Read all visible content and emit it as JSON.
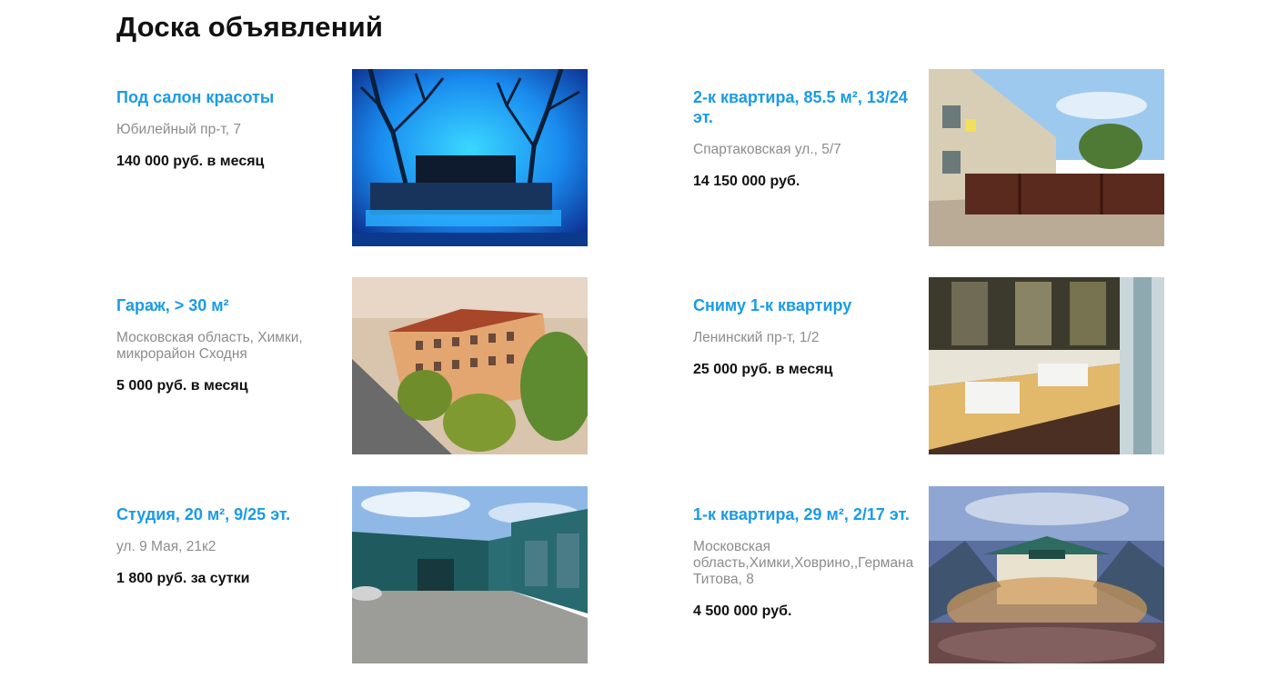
{
  "page": {
    "title": "Доска объявлений"
  },
  "listings": [
    {
      "title": "Под салон красоты",
      "address": "Юбилейный пр-т, 7",
      "price": "140 000 руб. в месяц",
      "photo": "blue-lit-room-photo"
    },
    {
      "title": "2-к квартира, 85.5 м², 13/24 эт.",
      "address": "Спартаковская ул., 5/7",
      "price": "14 150 000 руб.",
      "photo": "building-with-fence-photo"
    },
    {
      "title": "Гараж, > 30 м²",
      "address": "Московская область, Химки, микрорайон Сходня",
      "price": "5 000 руб. в месяц",
      "photo": "building-aerial-photo"
    },
    {
      "title": "Сниму 1-к квартиру",
      "address": "Ленинский пр-т, 1/2",
      "price": "25 000 руб. в месяц",
      "photo": "balcony-interior-photo"
    },
    {
      "title": "Студия, 20 м², 9/25 эт.",
      "address": "ул. 9 Мая, 21к2",
      "price": "1 800 руб. за сутки",
      "photo": "warehouse-photo"
    },
    {
      "title": "1-к квартира, 29 м², 2/17 эт.",
      "address": "Московская область,Химки,Ховрино,,Германа Титова, 8",
      "price": "4 500 000 руб.",
      "photo": "restaurant-terrace-photo"
    }
  ]
}
